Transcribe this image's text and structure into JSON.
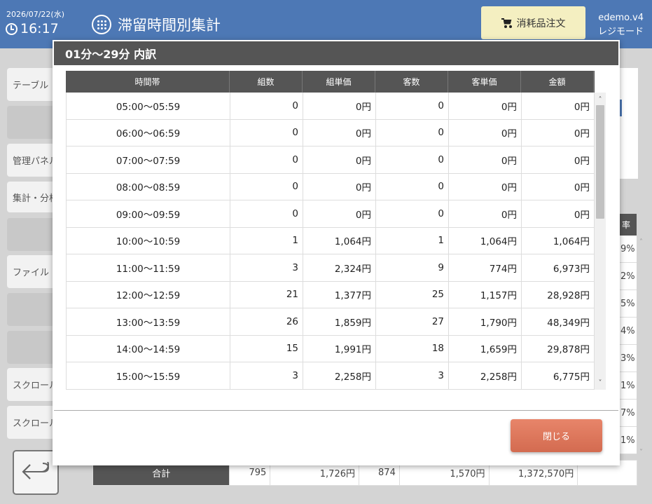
{
  "header": {
    "date": "2026/07/22(水)",
    "time": "16:17",
    "title": "滞留時間別集計",
    "order_button": "消耗品注文",
    "user": "edemo.v4",
    "mode": "レジモード",
    "accent_color": "#4d78b5"
  },
  "sidebar": {
    "items": [
      "テーブル",
      "",
      "管理パネル",
      "集計・分析",
      "",
      "ファイル",
      "",
      "",
      "スクロール",
      "スクロール"
    ]
  },
  "background": {
    "right_col_values": [
      "9%",
      "2%",
      "5%",
      "4%",
      "3%",
      "1%",
      "7%",
      "1%"
    ],
    "right_head": "率",
    "total": {
      "label": "合計",
      "groups": "795",
      "group_unit_price": "1,726円",
      "customers": "874",
      "customer_unit_price": "1,570円",
      "amount": "1,372,570円"
    }
  },
  "modal": {
    "title": "01分～29分 内訳",
    "columns": [
      "時間帯",
      "組数",
      "組単価",
      "客数",
      "客単価",
      "金額"
    ],
    "rows": [
      [
        "05:00～05:59",
        "0",
        "0円",
        "0",
        "0円",
        "0円"
      ],
      [
        "06:00～06:59",
        "0",
        "0円",
        "0",
        "0円",
        "0円"
      ],
      [
        "07:00～07:59",
        "0",
        "0円",
        "0",
        "0円",
        "0円"
      ],
      [
        "08:00～08:59",
        "0",
        "0円",
        "0",
        "0円",
        "0円"
      ],
      [
        "09:00～09:59",
        "0",
        "0円",
        "0",
        "0円",
        "0円"
      ],
      [
        "10:00～10:59",
        "1",
        "1,064円",
        "1",
        "1,064円",
        "1,064円"
      ],
      [
        "11:00～11:59",
        "3",
        "2,324円",
        "9",
        "774円",
        "6,973円"
      ],
      [
        "12:00～12:59",
        "21",
        "1,377円",
        "25",
        "1,157円",
        "28,928円"
      ],
      [
        "13:00～13:59",
        "26",
        "1,859円",
        "27",
        "1,790円",
        "48,349円"
      ],
      [
        "14:00～14:59",
        "15",
        "1,991円",
        "18",
        "1,659円",
        "29,878円"
      ],
      [
        "15:00～15:59",
        "3",
        "2,258円",
        "3",
        "2,258円",
        "6,775円"
      ]
    ],
    "close_button": "閉じる",
    "close_color": "#e07a5f"
  }
}
